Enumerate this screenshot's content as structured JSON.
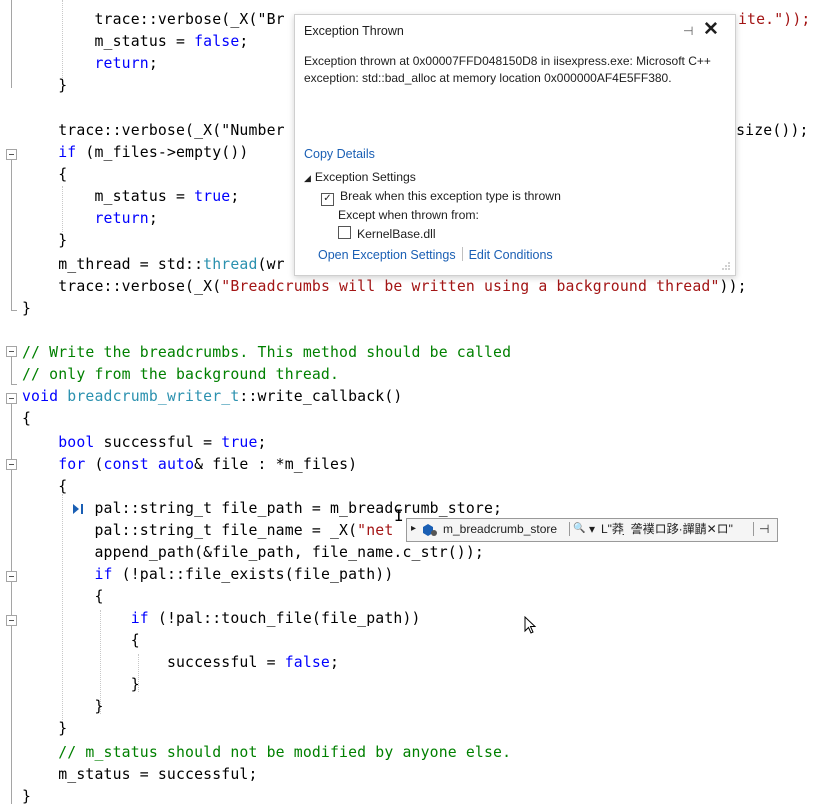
{
  "code": {
    "line_1": {
      "indent": "        ",
      "pre": "trace::verbose(_X(\"Br",
      "post": "ite.\"));"
    },
    "line_2": {
      "indent": "        ",
      "a": "m_status = ",
      "kw": "false",
      "b": ";"
    },
    "line_3": {
      "indent": "        ",
      "kw": "return",
      "b": ";"
    },
    "line_4": {
      "indent": "    ",
      "a": "}"
    },
    "line_5": {
      "indent": "    ",
      "pre": "trace::verbose(_X(\"Number",
      "post": "->size());"
    },
    "line_6": {
      "indent": "    ",
      "kw": "if",
      "a": " (m_files->empty())"
    },
    "line_7": {
      "indent": "    ",
      "a": "{"
    },
    "line_8": {
      "indent": "        ",
      "a": "m_status = ",
      "kw": "true",
      "b": ";"
    },
    "line_9": {
      "indent": "        ",
      "kw": "return",
      "b": ";"
    },
    "line_10": {
      "indent": "    ",
      "a": "}"
    },
    "line_11": {
      "indent": "    ",
      "a": "m_thread = std::",
      "ty": "thread",
      "b": "(wr"
    },
    "line_12": {
      "indent": "    ",
      "a": "trace::verbose(_X(",
      "str": "\"Breadcrumbs will be written using a background thread\"",
      "b": "));"
    },
    "line_13": {
      "a": "}"
    },
    "line_14": {
      "cm": "// Write the breadcrumbs. This method should be called"
    },
    "line_15": {
      "cm": "// only from the background thread."
    },
    "line_16": {
      "kw": "void",
      "a": " ",
      "ty": "breadcrumb_writer_t",
      "b": "::write_callback()"
    },
    "line_17": {
      "a": "{"
    },
    "line_18": {
      "indent": "    ",
      "kw": "bool",
      "a": " successful = ",
      "kw2": "true",
      "b": ";"
    },
    "line_19": {
      "indent": "    ",
      "kw": "for",
      "a": " (",
      "kw2": "const",
      "b": " ",
      "kw3": "auto",
      "c": "& file : *m_files)"
    },
    "line_20": {
      "indent": "    ",
      "a": "{"
    },
    "line_21": {
      "indent": "        ",
      "a": "pal::string_t file_path = m_breadcrumb_store;"
    },
    "line_22": {
      "indent": "        ",
      "a": "pal::string_t file_name = _X(",
      "str": "\"net"
    },
    "line_23": {
      "indent": "        ",
      "a": "append_path(&file_path, file_name.c_str());"
    },
    "line_24": {
      "indent": "        ",
      "kw": "if",
      "a": " (!pal::file_exists(file_path))"
    },
    "line_25": {
      "indent": "        ",
      "a": "{"
    },
    "line_26": {
      "indent": "            ",
      "kw": "if",
      "a": " (!pal::touch_file(file_path))"
    },
    "line_27": {
      "indent": "            ",
      "a": "{"
    },
    "line_28": {
      "indent": "                ",
      "a": "successful = ",
      "kw": "false",
      "b": ";"
    },
    "line_29": {
      "indent": "            ",
      "a": "}"
    },
    "line_30": {
      "indent": "        ",
      "a": "}"
    },
    "line_31": {
      "indent": "    ",
      "a": "}"
    },
    "line_32": {
      "indent": "    ",
      "cm": "// m_status should not be modified by anyone else."
    },
    "line_33": {
      "indent": "    ",
      "a": "m_status = successful;"
    },
    "line_34": {
      "a": "}"
    }
  },
  "exception_popup": {
    "title": "Exception Thrown",
    "pin_glyph": "⊣",
    "close_glyph": "✕",
    "message": "Exception thrown at 0x00007FFD048150D8 in iisexpress.exe: Microsoft C++ exception: std::bad_alloc at memory location 0x000000AF4E5FF380.",
    "copy_details": "Copy Details",
    "settings_header": "Exception Settings",
    "settings_arrow": "◢",
    "break_label": "Break when this exception type is thrown",
    "break_checked": "✓",
    "except_label": "Except when thrown from:",
    "kernelbase_label": "KernelBase.dll",
    "open_settings": "Open Exception Settings",
    "edit_conditions": "Edit Conditions"
  },
  "datatip": {
    "expand_glyph": "▸",
    "name": "m_breadcrumb_store",
    "search_glyph": "🔍",
    "dropdown_glyph": "▾",
    "value": "L\"莽 ̣̣ 詟襆ロ跢·譂鼱✕ロ\"",
    "pin_glyph": "⊣"
  },
  "colors": {
    "keyword": "#0000ff",
    "string": "#a31515",
    "comment": "#008000",
    "type": "#2b91af",
    "link": "#1a5fb4"
  }
}
